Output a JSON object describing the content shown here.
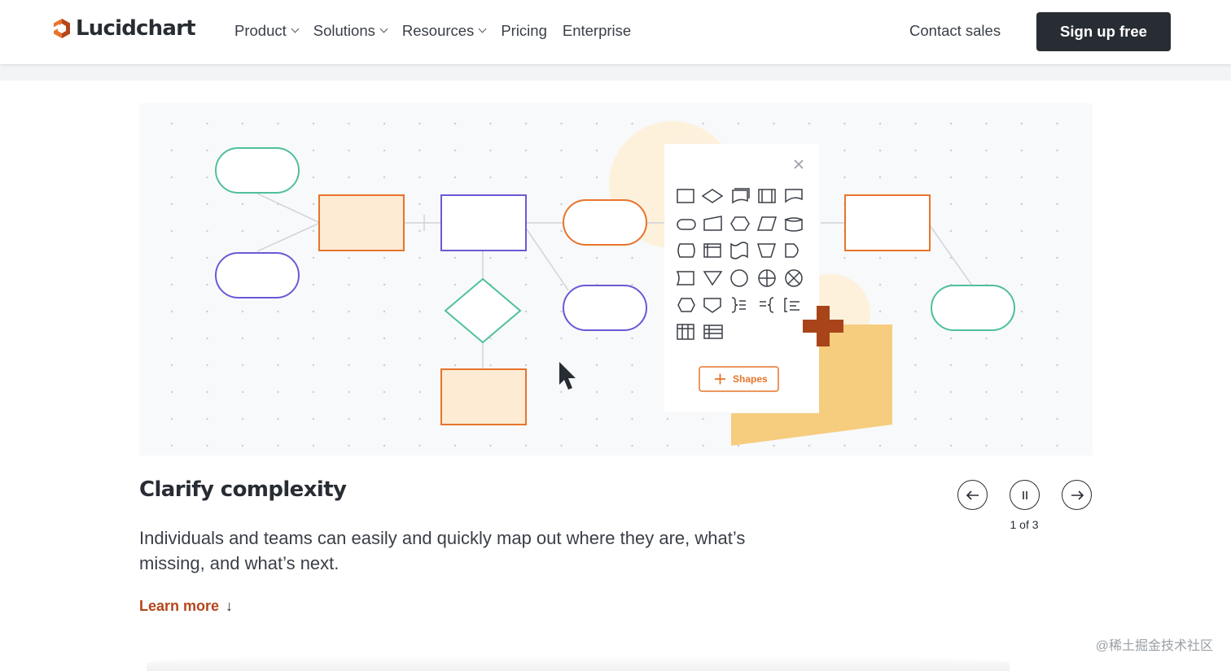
{
  "header": {
    "logo_text": "Lucidchart",
    "nav": [
      {
        "label": "Product",
        "has_dropdown": true
      },
      {
        "label": "Solutions",
        "has_dropdown": true
      },
      {
        "label": "Resources",
        "has_dropdown": true
      },
      {
        "label": "Pricing",
        "has_dropdown": false
      },
      {
        "label": "Enterprise",
        "has_dropdown": false
      }
    ],
    "contact_label": "Contact sales",
    "signup_label": "Sign up free"
  },
  "illustration": {
    "shapes_button_label": "Shapes",
    "close_icon": "close-icon",
    "colors": {
      "green": "#4fc09a",
      "purple": "#6b59d6",
      "orange": "#e8742c",
      "peach_fill": "#fdebd4",
      "gold": "#f6cd7e",
      "brown": "#a9441a",
      "canvas": "#f8f9fb"
    }
  },
  "slide": {
    "title": "Clarify complexity",
    "description": "Individuals and teams can easily and quickly map out where they are, what’s missing, and what’s next.",
    "learn_more_label": "Learn more",
    "learn_more_icon": "arrow-down-icon",
    "counter": "1 of 3",
    "current": 1,
    "total": 3
  },
  "controls": {
    "prev_icon": "arrow-left-icon",
    "pause_icon": "pause-icon",
    "next_icon": "arrow-right-icon"
  },
  "watermark": "@稀土掘金技术社区"
}
